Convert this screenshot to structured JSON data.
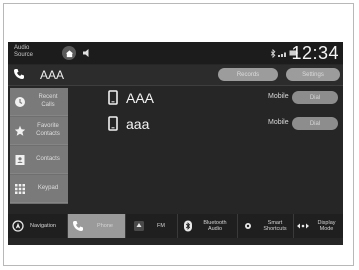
{
  "status_bar": {
    "audio_source_label": [
      "Audio",
      "Source"
    ],
    "clock": "12:34"
  },
  "header": {
    "device_name": "AAA",
    "buttons": {
      "records": "Records",
      "settings": "Settings"
    }
  },
  "sidebar": {
    "items": [
      {
        "label": [
          "Recent",
          "Calls"
        ],
        "icon": "clock-icon"
      },
      {
        "label": [
          "Favorite",
          "Contacts"
        ],
        "icon": "star-icon"
      },
      {
        "label": [
          "Contacts",
          ""
        ],
        "icon": "contacts-book-icon"
      },
      {
        "label": [
          "Keypad",
          ""
        ],
        "icon": "keypad-icon"
      }
    ]
  },
  "contacts": [
    {
      "name": "AAA",
      "type": "Mobile",
      "action": "Dial"
    },
    {
      "name": "aaa",
      "type": "Mobile",
      "action": "Dial"
    }
  ],
  "bottom_bar": {
    "items": [
      {
        "label": [
          "Navigation",
          ""
        ],
        "icon": "navigation-icon",
        "active": false
      },
      {
        "label": [
          "Phone",
          ""
        ],
        "icon": "phone-icon",
        "active": true
      },
      {
        "label": [
          "FM",
          ""
        ],
        "icon": "radio-icon",
        "active": false
      },
      {
        "label": [
          "Bluetooth",
          "Audio"
        ],
        "icon": "bluetooth-icon",
        "active": false
      },
      {
        "label": [
          "Smart",
          "Shortcuts"
        ],
        "icon": "smart-shortcuts-icon",
        "active": false
      },
      {
        "label": [
          "Display",
          "Mode"
        ],
        "icon": "display-mode-icon",
        "active": false
      }
    ]
  },
  "colors": {
    "screen_bg": "#262626",
    "sidebar_bg": "#7a7a7a",
    "active_tab": "#9a9a9a",
    "button_bg": "#8d8d8d"
  }
}
